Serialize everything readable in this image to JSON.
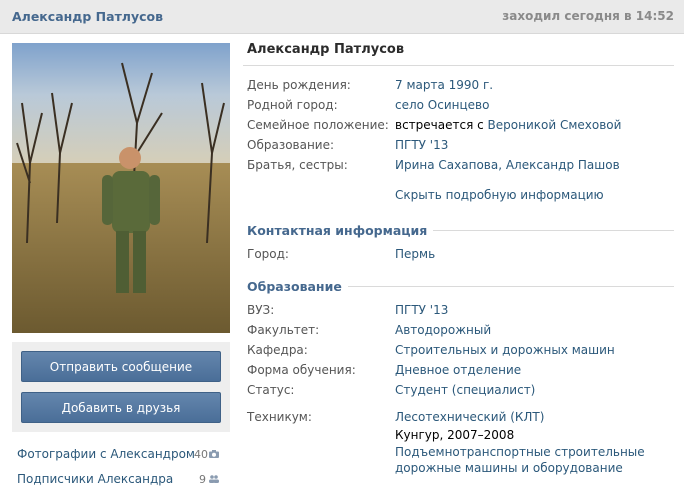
{
  "header": {
    "name": "Александр Патлусов",
    "online": "заходил сегодня в 14:52"
  },
  "sidebar": {
    "send_message": "Отправить сообщение",
    "add_friend": "Добавить в друзья",
    "photos_label": "Фотографии с Александром",
    "photos_count": "40",
    "followers_label": "Подписчики Александра",
    "followers_count": "9"
  },
  "profile": {
    "name": "Александр Патлусов",
    "info": [
      {
        "label": "День рождения:",
        "value": "7 марта 1990 г."
      },
      {
        "label": "Родной город:",
        "value": "село Осинцево"
      },
      {
        "label": "Семейное положение:",
        "value_prefix": "встречается с ",
        "value": "Вероникой Смеховой"
      },
      {
        "label": "Образование:",
        "value": "ПГТУ '13"
      },
      {
        "label": "Братья, сестры:",
        "value": "Ирина Сахапова, Александр Пашов"
      }
    ],
    "toggle": "Скрыть подробную информацию",
    "contacts": {
      "title": "Контактная информация",
      "city_label": "Город:",
      "city": "Пермь"
    },
    "education": {
      "title": "Образование",
      "rows": [
        {
          "label": "ВУЗ:",
          "value": "ПГТУ '13"
        },
        {
          "label": "Факультет:",
          "value": "Автодорожный"
        },
        {
          "label": "Кафедра:",
          "value": "Строительных и дорожных машин"
        },
        {
          "label": "Форма обучения:",
          "value": "Дневное отделение"
        },
        {
          "label": "Статус:",
          "value": "Студент (специалист)"
        }
      ],
      "tech_label": "Техникум:",
      "tech_name": "Лесотехнический (КЛТ)",
      "tech_years": "Кунгур, 2007–2008",
      "tech_spec_1": "Подъемнотранспортные строительные",
      "tech_spec_2": "дорожные машины и оборудование"
    }
  },
  "colors": {
    "link": "#2b587a",
    "accent": "#45688e",
    "button": "#5b7fa6"
  }
}
